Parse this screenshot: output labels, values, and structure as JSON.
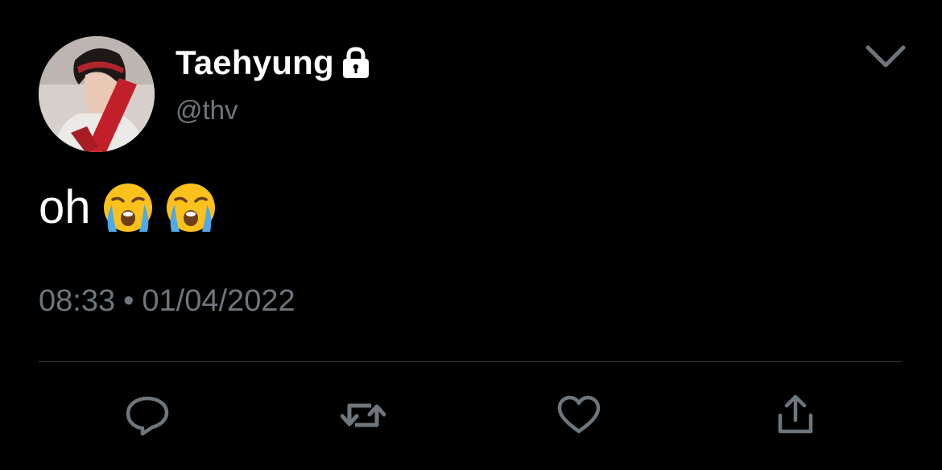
{
  "tweet": {
    "author": {
      "display_name": "Taehyung",
      "handle": "@thv",
      "protected_icon": "lock-icon",
      "avatar_icon": "profile-photo"
    },
    "text": "oh",
    "emojis": [
      "loudly-crying-face",
      "loudly-crying-face"
    ],
    "time": "08:33",
    "separator": "•",
    "date": "01/04/2022"
  },
  "actions": {
    "reply_icon": "reply-icon",
    "retweet_icon": "retweet-icon",
    "like_icon": "heart-icon",
    "share_icon": "share-icon",
    "menu_icon": "chevron-down-icon"
  },
  "colors": {
    "background": "#000000",
    "primary_text": "#ffffff",
    "secondary_text": "#6e767d",
    "divider": "#3a3d40",
    "icon": "#6e767d"
  }
}
